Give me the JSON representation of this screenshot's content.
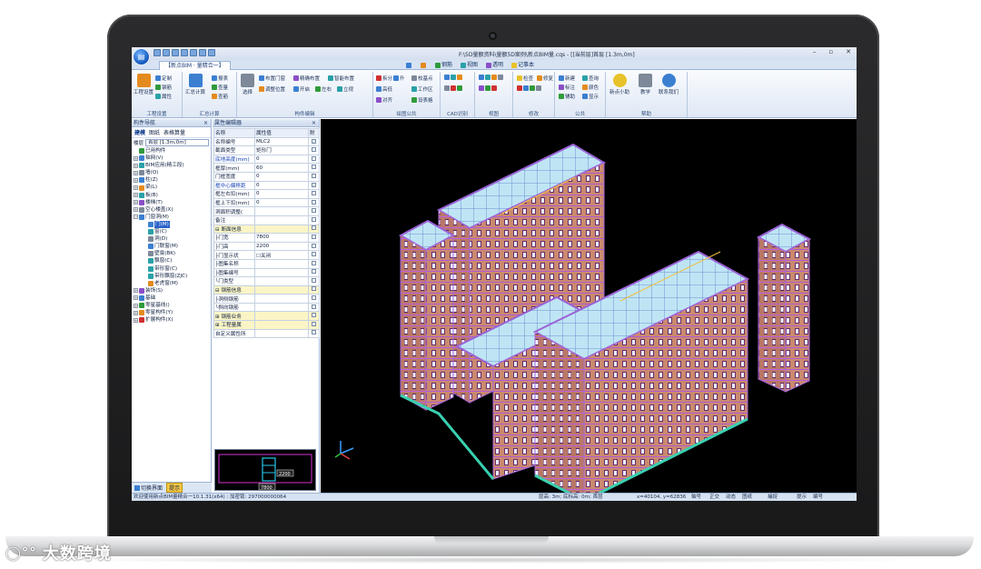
{
  "window": {
    "app_orb": "",
    "title": "F:\\5D量额资料\\量额5D案例\\新点BIM量.cqs - [[当前层]首层 [1.3m,0m]",
    "controls": [
      "–",
      "▫",
      "✕"
    ],
    "document_tab": "【新点BIM · 量精合一】"
  },
  "ribbon_tabs": [
    {
      "label": "",
      "icon": "zoom-fit-icon"
    },
    {
      "label": "",
      "icon": "find-icon"
    },
    {
      "label": "钢筋",
      "icon": "rebar-icon"
    },
    {
      "label": "视图",
      "icon": "view-icon"
    },
    {
      "label": "透明",
      "icon": "transparent-icon"
    },
    {
      "label": "记事本",
      "icon": "notepad-icon"
    }
  ],
  "ribbon": {
    "groups": [
      {
        "label": "工程设置",
        "big": "工程设置",
        "small": [
          "定制",
          "钢筋",
          "属性"
        ]
      },
      {
        "label": "汇总计算",
        "big": "汇总计算",
        "small": [
          "报表",
          "查量",
          "查筋"
        ]
      },
      {
        "label": "构件编辑",
        "big": "选择",
        "small": [
          "布置门窗",
          "精确布置",
          "智能布置",
          "调整位置",
          "开启",
          "左右",
          "立视"
        ]
      },
      {
        "label": "绘图公共",
        "small": [
          "拆分",
          "升",
          "校基点",
          "高低",
          "工作区",
          "对齐",
          "设表格"
        ]
      },
      {
        "label": "CAD识别",
        "small": []
      },
      {
        "label": "视图",
        "small": []
      },
      {
        "label": "修改",
        "small": [
          "检查",
          "修复"
        ]
      },
      {
        "label": "公共",
        "small": [
          "新建",
          "查询",
          "标注",
          "颜色",
          "辅助",
          "显示"
        ]
      },
      {
        "label": "帮助",
        "small": [
          "新点小助",
          "教学",
          "联系我们"
        ]
      }
    ]
  },
  "nav_panel": {
    "title": "构件导航",
    "close": "×",
    "subtabs": [
      "建模",
      "图纸",
      "表格算量"
    ],
    "floor_label": "楼层",
    "floor_value": "首层 [1.3m,0m]",
    "tree": [
      {
        "label": "已用构件",
        "expand": "",
        "icon": "c-green"
      },
      {
        "label": "轴网(V)",
        "expand": "+",
        "icon": "c-blue"
      },
      {
        "label": "BIM应用(精工段)",
        "expand": "+",
        "icon": "c-teal"
      },
      {
        "label": "墙(Q)",
        "expand": "+",
        "icon": "c-gray"
      },
      {
        "label": "柱(Z)",
        "expand": "+",
        "icon": "c-blue"
      },
      {
        "label": "梁(L)",
        "expand": "+",
        "icon": "c-orange"
      },
      {
        "label": "板(B)",
        "expand": "+",
        "icon": "c-teal"
      },
      {
        "label": "楼梯(T)",
        "expand": "+",
        "icon": "c-purple"
      },
      {
        "label": "空心楼盖(X)",
        "expand": "+",
        "icon": "c-gray"
      },
      {
        "label": "门窗洞(M)",
        "expand": "−",
        "icon": "c-blue"
      },
      {
        "label": "门(M)",
        "expand": "",
        "icon": "c-blue",
        "selected": true,
        "indent": 2
      },
      {
        "label": "窗(C)",
        "expand": "",
        "icon": "c-teal",
        "indent": 2
      },
      {
        "label": "洞(D)",
        "expand": "",
        "icon": "c-gray",
        "indent": 2
      },
      {
        "label": "门联窗(M)",
        "expand": "",
        "icon": "c-blue",
        "indent": 2
      },
      {
        "label": "壁龛(BK)",
        "expand": "",
        "icon": "c-gray",
        "indent": 2
      },
      {
        "label": "飘窗(C)",
        "expand": "",
        "icon": "c-teal",
        "indent": 2
      },
      {
        "label": "带形窗(C)",
        "expand": "",
        "icon": "c-teal",
        "indent": 2
      },
      {
        "label": "带形飘窗(ZJC)",
        "expand": "",
        "icon": "c-teal",
        "indent": 2
      },
      {
        "label": "老虎窗(M)",
        "expand": "",
        "icon": "c-orange",
        "indent": 2
      },
      {
        "label": "装饰(S)",
        "expand": "+",
        "icon": "c-purple"
      },
      {
        "label": "基础",
        "expand": "+",
        "icon": "c-blue"
      },
      {
        "label": "零星基线()",
        "expand": "+",
        "icon": "c-green"
      },
      {
        "label": "零星构件(Y)",
        "expand": "+",
        "icon": "c-orange"
      },
      {
        "label": "扩展构件(X)",
        "expand": "+",
        "icon": "c-red"
      }
    ],
    "bottom_buttons": [
      "切换界面",
      "提示"
    ]
  },
  "prop_panel": {
    "title": "属性编辑器",
    "close": "×",
    "headers": [
      "名称",
      "属性值",
      "附"
    ],
    "rows": [
      {
        "name": "名称编号",
        "value": "MLC2",
        "checked": true,
        "style": ""
      },
      {
        "name": "截面类型",
        "value": "矩形门",
        "checked": false,
        "style": ""
      },
      {
        "name": "底地高度(mm)",
        "value": "0",
        "checked": false,
        "style": "blue"
      },
      {
        "name": "框厚(mm)",
        "value": "60",
        "checked": false,
        "style": ""
      },
      {
        "name": "门框宽度",
        "value": "0",
        "checked": false,
        "style": ""
      },
      {
        "name": "框中心偏移距",
        "value": "0",
        "checked": true,
        "style": "blue"
      },
      {
        "name": "框左右扣(mm)",
        "value": "0",
        "checked": false,
        "style": ""
      },
      {
        "name": "框上下扣(mm)",
        "value": "0",
        "checked": false,
        "style": ""
      },
      {
        "name": "洞面积调整(",
        "value": "",
        "checked": false,
        "style": ""
      },
      {
        "name": "备注",
        "value": "",
        "checked": false,
        "style": ""
      },
      {
        "name": "⊟ 断面信息",
        "value": "",
        "checked": false,
        "style": "grp"
      },
      {
        "name": "├门宽",
        "value": "7800",
        "checked": false,
        "style": ""
      },
      {
        "name": "├门高",
        "value": "2200",
        "checked": false,
        "style": ""
      },
      {
        "name": "├门显示状",
        "value": "☐关闭",
        "checked": false,
        "style": ""
      },
      {
        "name": "├图集名称",
        "value": "",
        "checked": false,
        "style": ""
      },
      {
        "name": "├图集编号",
        "value": "",
        "checked": false,
        "style": ""
      },
      {
        "name": "└门类型",
        "value": "",
        "checked": false,
        "style": ""
      },
      {
        "name": "⊟ 钢筋信息",
        "value": "",
        "checked": false,
        "style": "grp"
      },
      {
        "name": "├洞侧钢筋",
        "value": "",
        "checked": false,
        "style": ""
      },
      {
        "name": "└斜向钢筋",
        "value": "",
        "checked": false,
        "style": ""
      },
      {
        "name": "⊞ 钢筋业务",
        "value": "",
        "checked": false,
        "style": "grp"
      },
      {
        "name": "⊞ 工程量属",
        "value": "",
        "checked": false,
        "style": "grp"
      },
      {
        "name": "自定义属性所",
        "value": "",
        "checked": false,
        "style": ""
      }
    ],
    "preview": {
      "width_label": "7800",
      "height_label": "2200"
    }
  },
  "statusbar": {
    "left": "欢迎使用新点BIM量精合一10.1.31(x64) : 加密锁: 297000000064",
    "floor": "层高: 3m; 底标高: 0m; 首层",
    "coords": "x=40104, y=62836",
    "snap": [
      "轴号",
      "正交",
      "动态",
      "图纸",
      "捕捉",
      "提示",
      "编号"
    ]
  }
}
